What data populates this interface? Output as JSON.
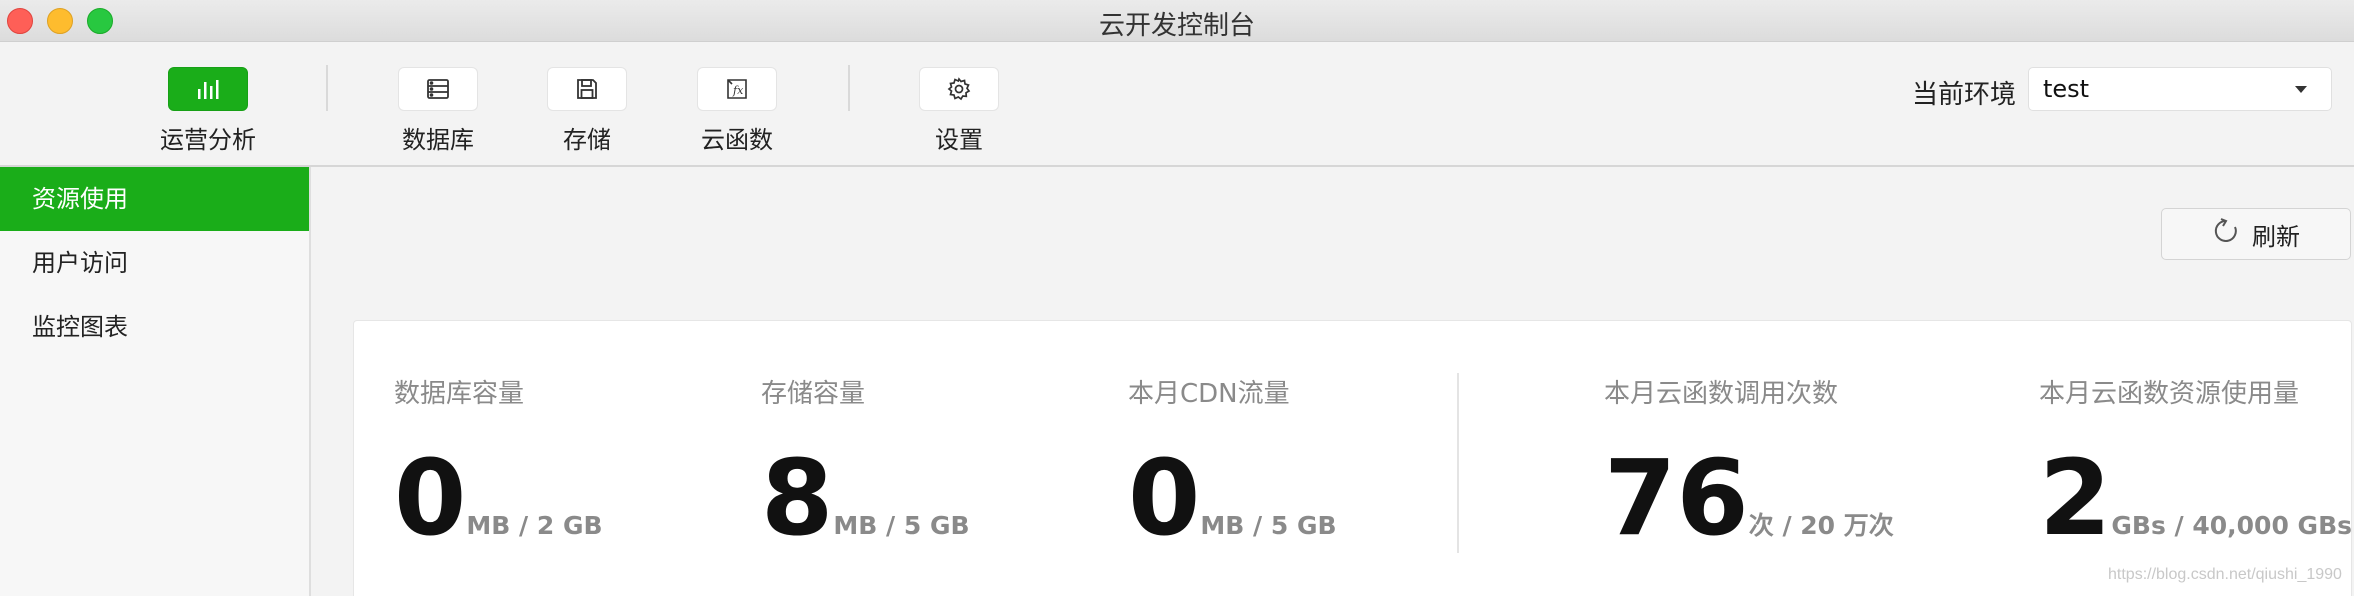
{
  "window": {
    "title": "云开发控制台"
  },
  "toolbar": {
    "items": [
      {
        "label": "运营分析",
        "icon": "bar-chart-icon",
        "active": true
      },
      {
        "label": "数据库",
        "icon": "database-icon"
      },
      {
        "label": "存储",
        "icon": "floppy-disk-icon"
      },
      {
        "label": "云函数",
        "icon": "function-fx-icon"
      },
      {
        "label": "设置",
        "icon": "gear-icon"
      }
    ],
    "env_label": "当前环境",
    "env_value": "test"
  },
  "sidebar": {
    "items": [
      {
        "label": "资源使用",
        "active": true
      },
      {
        "label": "用户访问"
      },
      {
        "label": "监控图表"
      }
    ]
  },
  "main": {
    "refresh_label": "刷新",
    "metrics": [
      {
        "label": "数据库容量",
        "value": "0",
        "unit": "MB / 2 GB"
      },
      {
        "label": "存储容量",
        "value": "8",
        "unit": "MB / 5 GB"
      },
      {
        "label": "本月CDN流量",
        "value": "0",
        "unit": "MB / 5 GB"
      },
      {
        "label": "本月云函数调用次数",
        "value": "76",
        "unit": "次 / 20 万次"
      },
      {
        "label": "本月云函数资源使用量",
        "value": "2",
        "unit": "GBs / 40,000 GBs"
      }
    ]
  },
  "watermark": "https://blog.csdn.net/qiushi_1990",
  "colors": {
    "accent": "#1aad19"
  }
}
